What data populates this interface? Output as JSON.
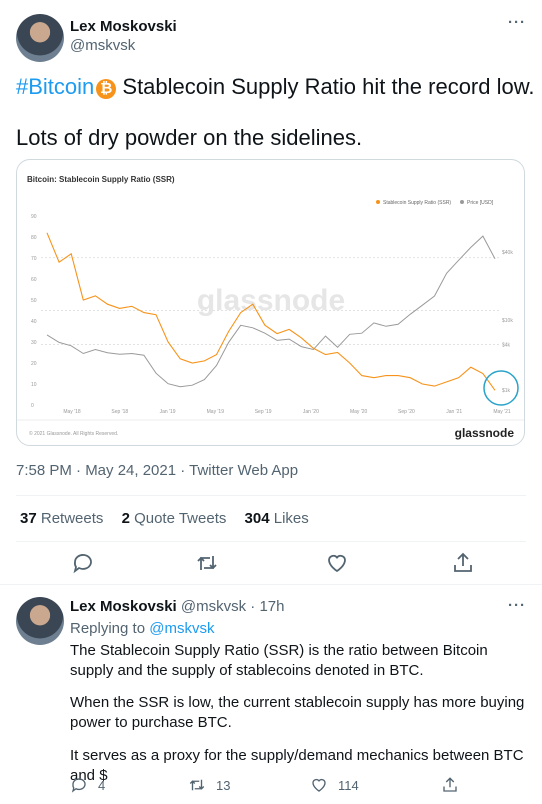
{
  "author": {
    "name": "Lex Moskovski",
    "handle": "@mskvsk"
  },
  "tweet": {
    "hashtag": "#Bitcoin",
    "line1_rest": " Stablecoin Supply Ratio hit the record low.",
    "line2": "Lots of dry powder on the sidelines.",
    "timestamp": "7:58 PM · May 24, 2021 · Twitter Web App"
  },
  "chart_card": {
    "title": "Bitcoin: Stablecoin Supply Ratio (SSR)",
    "legend": [
      "Stablecoin Supply Ratio (SSR)",
      "Price [USD]"
    ],
    "watermark": "glassnode",
    "copyright": "© 2021 Glassnode. All Rights Reserved.",
    "brand": "glassnode",
    "colors": {
      "ssr": "#f7931a",
      "price": "#9a9a9a",
      "highlight": "#2aa3c9"
    }
  },
  "chart_data": {
    "type": "line",
    "title": "Bitcoin: Stablecoin Supply Ratio (SSR)",
    "x_ticks": [
      "May '18",
      "Sep '18",
      "Jan '19",
      "May '19",
      "Sep '19",
      "Jan '20",
      "May '20",
      "Sep '20",
      "Jan '21",
      "May '21"
    ],
    "y_left_ticks": [
      "0",
      "10",
      "20",
      "30",
      "40",
      "50",
      "60",
      "70",
      "80",
      "90"
    ],
    "y_right_ticks": [
      "$40k",
      "$10k",
      "$4k",
      "$1k"
    ],
    "ylim_left": [
      0,
      90
    ],
    "series": [
      {
        "name": "Stablecoin Supply Ratio (SSR)",
        "x": [
          0,
          1,
          2,
          3,
          4,
          5,
          6,
          7,
          8,
          9,
          10,
          11,
          12,
          13,
          14,
          15,
          16,
          17,
          18,
          19,
          20,
          21,
          22,
          23,
          24,
          25,
          26,
          27,
          28,
          29,
          30,
          31,
          32,
          33,
          34,
          35,
          36,
          37
        ],
        "values": [
          82,
          68,
          72,
          50,
          52,
          48,
          46,
          47,
          44,
          43,
          30,
          22,
          20,
          21,
          24,
          35,
          44,
          48,
          38,
          34,
          36,
          32,
          27,
          24,
          25,
          20,
          14,
          13,
          14,
          14,
          13,
          10,
          9,
          11,
          13,
          18,
          15,
          7
        ]
      },
      {
        "name": "Price [USD]",
        "x": [
          0,
          1,
          2,
          3,
          4,
          5,
          6,
          7,
          8,
          9,
          10,
          11,
          12,
          13,
          14,
          15,
          16,
          17,
          18,
          19,
          20,
          21,
          22,
          23,
          24,
          25,
          26,
          27,
          28,
          29,
          30,
          31,
          32,
          33,
          34,
          35,
          36,
          37
        ],
        "values": [
          9200,
          8000,
          7500,
          6500,
          7000,
          6600,
          6400,
          6500,
          6300,
          4500,
          3700,
          3500,
          3600,
          4000,
          5200,
          8000,
          11000,
          10500,
          9500,
          8300,
          8500,
          7400,
          7000,
          9000,
          7300,
          9300,
          9500,
          11500,
          10800,
          11200,
          13500,
          16000,
          19000,
          29000,
          37000,
          47000,
          58000,
          38000
        ]
      }
    ]
  },
  "engagement": {
    "retweets_count": "37",
    "retweets_label": "Retweets",
    "quotes_count": "2",
    "quotes_label": "Quote Tweets",
    "likes_count": "304",
    "likes_label": "Likes"
  },
  "reply": {
    "name": "Lex Moskovski",
    "handle_time": "@mskvsk · 17h",
    "replying_prefix": "Replying to ",
    "replying_to": "@mskvsk",
    "p1": "The Stablecoin Supply Ratio (SSR) is the ratio between Bitcoin supply and the supply of stablecoins denoted in BTC.",
    "p2": "When the SSR is low, the current stablecoin supply has more buying power to purchase BTC.",
    "p3": "It serves as a proxy for the supply/demand mechanics between BTC and $",
    "replies": "4",
    "retweets": "13",
    "likes": "114"
  }
}
